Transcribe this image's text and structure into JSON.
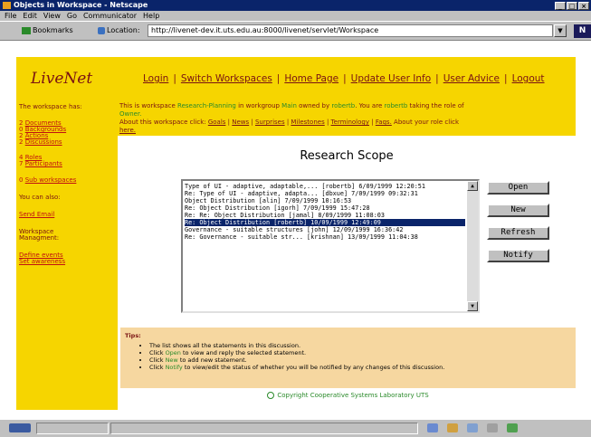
{
  "window": {
    "title": "Objects in Workspace - Netscape",
    "controls": [
      "_",
      "□",
      "×"
    ]
  },
  "menu": [
    "File",
    "Edit",
    "View",
    "Go",
    "Communicator",
    "Help"
  ],
  "toolbar": {
    "bookmarks_label": "Bookmarks",
    "location_label": "Location:",
    "url": "http://livenet-dev.it.uts.edu.au:8000/livenet/servlet/Workspace",
    "logo": "N"
  },
  "header": {
    "logo": "LiveNet",
    "nav": [
      "Login",
      "Switch Workspaces",
      "Home Page",
      "Update User Info",
      "User Advice",
      "Logout"
    ]
  },
  "sidebar": {
    "title": "The workspace has:",
    "items": [
      {
        "count": "2",
        "label": "Documents"
      },
      {
        "count": "0",
        "label": "Backgrounds"
      },
      {
        "count": "2",
        "label": "Actions"
      },
      {
        "count": "2",
        "label": "Discussions"
      },
      {
        "count": "4",
        "label": "Roles"
      },
      {
        "count": "7",
        "label": "Participants"
      },
      {
        "count": "0",
        "label": "Sub workspaces"
      }
    ],
    "also_label": "You can also:",
    "send_email": "Send Email",
    "mgmt_line1": "Workspace",
    "mgmt_line2": "Managment:",
    "define_events": "Define events",
    "set_awareness": "Set awareness"
  },
  "info": {
    "t1": "This is workspace ",
    "workspace": "Research-Planning",
    "t2": " in workgroup ",
    "workgroup": "Main",
    "t3": " owned by ",
    "owner": "robertb",
    "t4": ". You are ",
    "user": "robertb",
    "t5": " taking the role of",
    "role": "Owner.",
    "about_text": "About this workspace click: ",
    "about_links": [
      "Goals",
      "News",
      "Surprises",
      "Milestones",
      "Terminology",
      "Faqs."
    ],
    "role_text": " About your role click",
    "here": "here."
  },
  "page_title": "Research Scope",
  "discussions": [
    "Type of UI - adaptive, adaptable,... [robertb] 6/09/1999 12:20:51",
    "  Re: Type of UI - adaptive, adapta... [dbxue] 7/09/1999 09:32:31",
    "Object Distribution [alin] 7/09/1999 10:16:53",
    "  Re: Object Distribution [igorh] 7/09/1999 15:47:28",
    "    Re: Re: Object Distribution [jamal] 8/09/1999 11:08:03",
    "  Re: Object Distribution [robertb] 10/09/1999 12:49:09",
    "Governance - suitable structures [john] 12/09/1999 16:36:42",
    "  Re: Governance - suitable str... [krishnan] 13/09/1999 11:04:38"
  ],
  "selected_index": 5,
  "buttons": {
    "open": "Open",
    "new": "New",
    "refresh": "Refresh",
    "notify": "Notify"
  },
  "tips": {
    "title": "Tips:",
    "lines": [
      {
        "pre": "The list shows all the statements in this discussion.",
        "hl": "",
        "post": ""
      },
      {
        "pre": "Click ",
        "hl": "Open",
        "post": " to view and reply the selected statement."
      },
      {
        "pre": "Click ",
        "hl": "New",
        "post": " to add new statement."
      },
      {
        "pre": "Click ",
        "hl": "Notify",
        "post": " to view/edit the status of whether you will be notified by any changes of this discussion."
      }
    ]
  },
  "copyright": "Copyright Cooperative Systems Laboratory UTS"
}
